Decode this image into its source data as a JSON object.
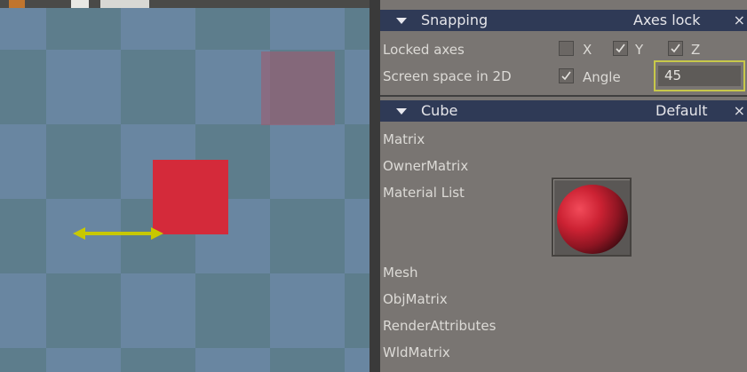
{
  "snapping": {
    "title": "Snapping",
    "preset": "Axes lock",
    "close": "×",
    "locked_axes_label": "Locked axes",
    "axes": [
      {
        "label": "X",
        "checked": false
      },
      {
        "label": "Y",
        "checked": true
      },
      {
        "label": "Z",
        "checked": true
      }
    ],
    "screen_space_label": "Screen space in 2D",
    "screen_space_checked": true,
    "angle_label": "Angle",
    "angle_value": "45"
  },
  "cube": {
    "title": "Cube",
    "preset": "Default",
    "close": "×",
    "properties": [
      "Matrix",
      "OwnerMatrix",
      "Material List",
      "Mesh",
      "ObjMatrix",
      "RenderAttributes",
      "WldMatrix"
    ]
  },
  "colors": {
    "header_bg": "#2f3a56",
    "panel_bg": "#797572",
    "cube_red": "#d42a3a",
    "arrow_yellow": "#c8c800",
    "input_highlight": "#c8c84a"
  }
}
